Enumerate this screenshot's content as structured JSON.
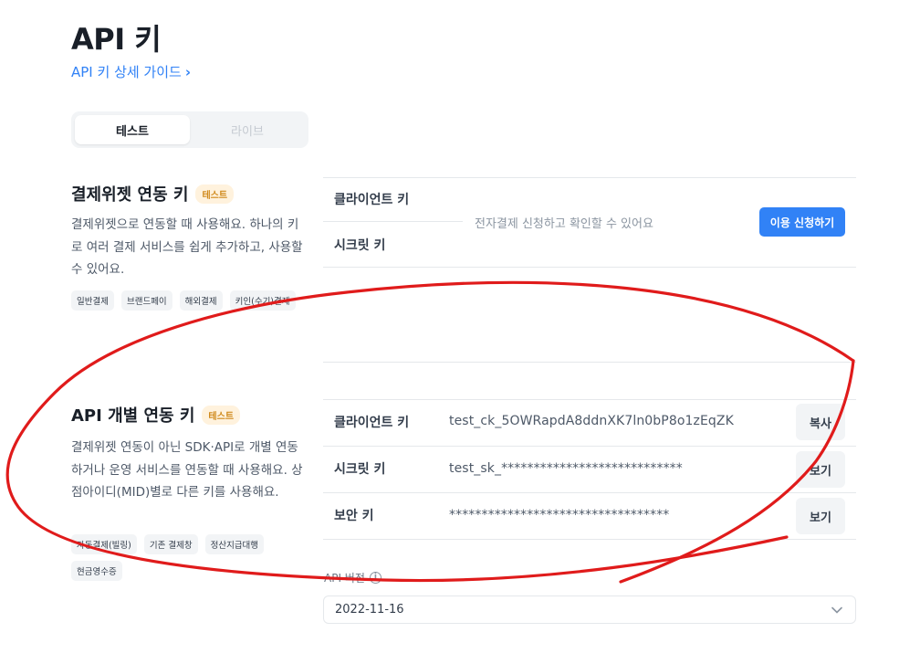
{
  "page": {
    "title": "API 키",
    "guide_link": "API 키 상세 가이드"
  },
  "mode_tabs": {
    "test": "테스트",
    "live": "라이브"
  },
  "widget_section": {
    "title": "결제위젯 연동 키",
    "badge": "테스트",
    "description": "결제위젯으로 연동할 때 사용해요. 하나의 키로 여러 결제 서비스를 쉽게 추가하고, 사용할 수 있어요.",
    "tags": [
      "일반결제",
      "브랜드페이",
      "해외결제",
      "키인(수기)결제"
    ],
    "client_key_label": "클라이언트 키",
    "secret_key_label": "시크릿 키",
    "notice": "전자결제 신청하고 확인할 수 있어요",
    "apply_button": "이용 신청하기"
  },
  "individual_section": {
    "title": "API 개별 연동 키",
    "badge": "테스트",
    "description": "결제위젯 연동이 아닌 SDK·API로 개별 연동하거나 운영 서비스를 연동할 때 사용해요. 상점아이디(MID)별로 다른 키를 사용해요.",
    "tags": [
      "자동결제(빌링)",
      "기존 결제창",
      "정산지급대행",
      "현금영수증"
    ],
    "rows": [
      {
        "label": "클라이언트 키",
        "value": "test_ck_5OWRapdA8ddnXK7ln0bP8o1zEqZK",
        "button": "복사"
      },
      {
        "label": "시크릿 키",
        "value": "test_sk_****************************",
        "button": "보기"
      },
      {
        "label": "보안 키",
        "value": "**********************************",
        "button": "보기"
      }
    ],
    "api_version_label": "API 버전",
    "api_version_value": "2022-11-16"
  },
  "colors": {
    "accent": "#3182f6",
    "badge_text": "#d08a1c",
    "badge_bg": "#fff2dd",
    "annotation": "#e01b1b"
  },
  "icons": {
    "guide_chevron": "chevron-right-icon",
    "info": "info-icon",
    "dropdown": "chevron-down-icon"
  }
}
